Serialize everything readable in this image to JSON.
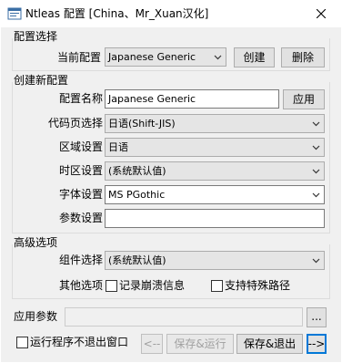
{
  "window": {
    "title": "Ntleas 配置 [China、Mr_Xuan汉化]",
    "icon": "app-icon",
    "close_icon": "close-icon"
  },
  "config_select": {
    "group_label": "配置选择",
    "current_label": "当前配置",
    "current_value": "Japanese Generic",
    "create_label": "创建",
    "delete_label": "删除"
  },
  "new_config": {
    "group_label": "创建新配置",
    "name_label": "配置名称",
    "name_value": "Japanese Generic",
    "apply_label": "应用",
    "codepage_label": "代码页选择",
    "codepage_value": "日语(Shift-JIS)",
    "region_label": "区域设置",
    "region_value": "日语",
    "timezone_label": "时区设置",
    "timezone_value": "(系统默认值)",
    "font_label": "字体设置",
    "font_value": "MS PGothic",
    "param_label": "参数设置",
    "param_value": ""
  },
  "advanced": {
    "group_label": "高级选项",
    "component_label": "组件选择",
    "component_value": "(系统默认值)",
    "other_label": "其他选项",
    "log_crash_label": "记录崩溃信息",
    "special_path_label": "支持特殊路径"
  },
  "app_params": {
    "label": "应用参数",
    "value": "",
    "browse_label": "..."
  },
  "footer": {
    "keep_window_label": "运行程序不退出窗口",
    "back_label": "<--",
    "save_run_label": "保存&运行",
    "save_exit_label": "保存&退出",
    "next_label": "-->"
  },
  "colors": {
    "accent": "#0078d7",
    "client_bg": "#f0f0f0"
  }
}
